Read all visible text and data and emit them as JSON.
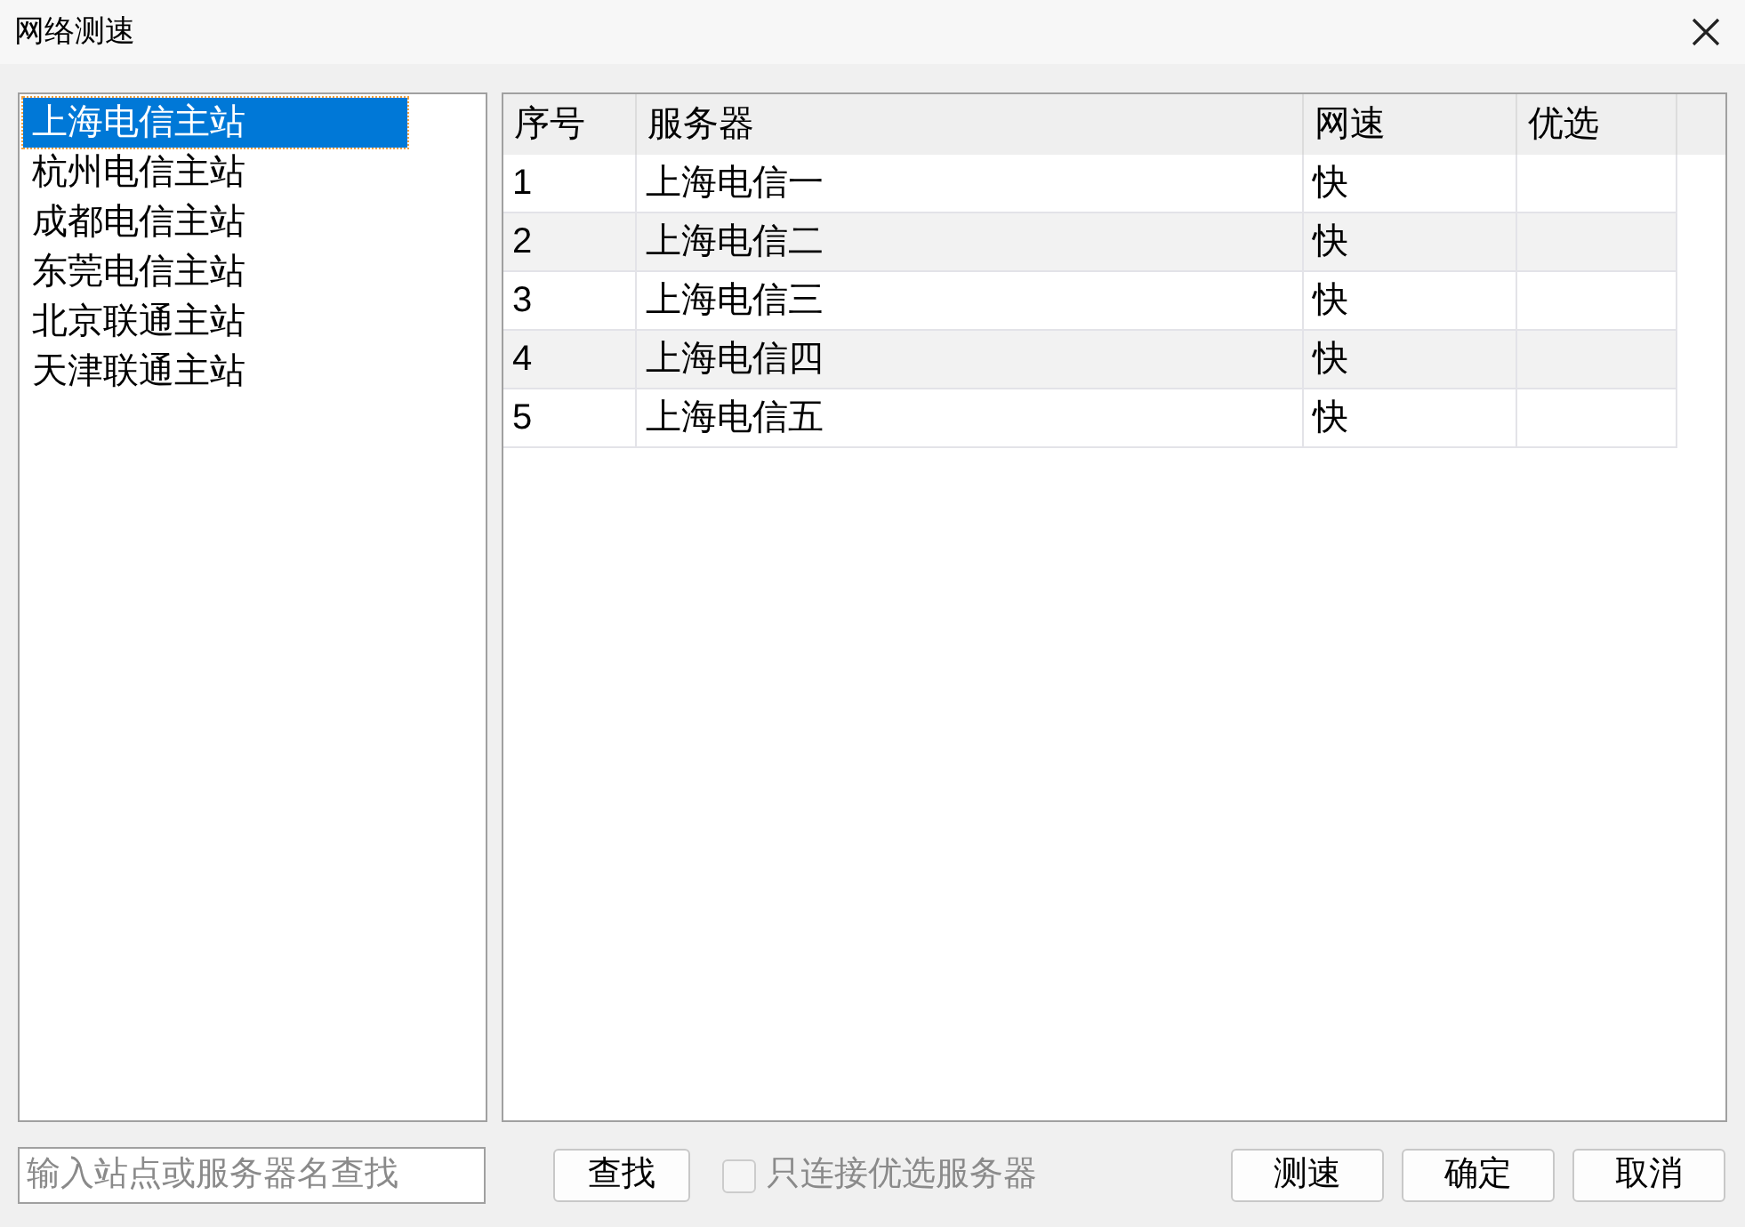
{
  "window": {
    "title": "网络测速"
  },
  "stations": [
    {
      "label": "上海电信主站",
      "selected": true
    },
    {
      "label": "杭州电信主站",
      "selected": false
    },
    {
      "label": "成都电信主站",
      "selected": false
    },
    {
      "label": "东莞电信主站",
      "selected": false
    },
    {
      "label": "北京联通主站",
      "selected": false
    },
    {
      "label": "天津联通主站",
      "selected": false
    }
  ],
  "table": {
    "columns": [
      "序号",
      "服务器",
      "网速",
      "优选"
    ],
    "rows": [
      [
        "1",
        "上海电信一",
        "快",
        ""
      ],
      [
        "2",
        "上海电信二",
        "快",
        ""
      ],
      [
        "3",
        "上海电信三",
        "快",
        ""
      ],
      [
        "4",
        "上海电信四",
        "快",
        ""
      ],
      [
        "5",
        "上海电信五",
        "快",
        ""
      ]
    ]
  },
  "search": {
    "placeholder": "输入站点或服务器名查找",
    "button": "查找"
  },
  "preferred_only": {
    "label": "只连接优选服务器",
    "checked": false,
    "disabled": true
  },
  "buttons": [
    "测速",
    "确定",
    "取消"
  ]
}
